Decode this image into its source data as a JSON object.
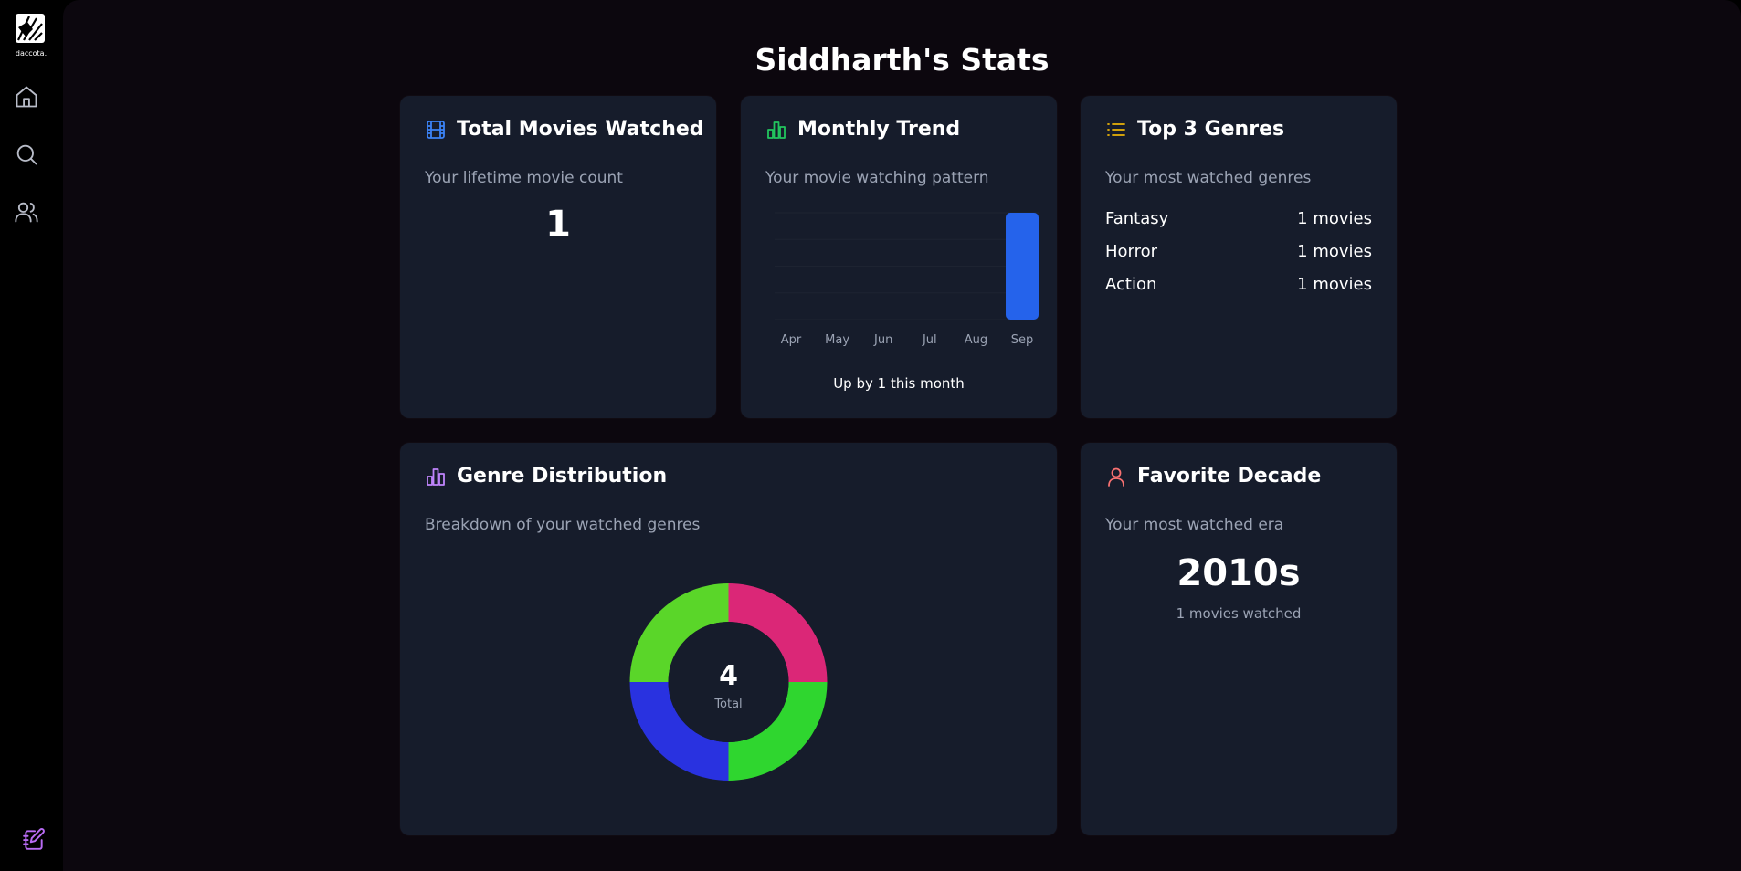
{
  "sidebar": {
    "logo_text": "daccota.",
    "items": [
      {
        "icon": "home-icon"
      },
      {
        "icon": "search-icon"
      },
      {
        "icon": "users-icon"
      }
    ],
    "bottom_icon": "edit-notebook-icon"
  },
  "page": {
    "title": "Siddharth's Stats"
  },
  "total_movies": {
    "title": "Total Movies Watched",
    "subtitle": "Your lifetime movie count",
    "value": "1",
    "icon": "film-icon",
    "icon_color": "#3b82f6"
  },
  "monthly_trend": {
    "title": "Monthly Trend",
    "subtitle": "Your movie watching pattern",
    "note": "Up by 1 this month",
    "icon": "bar-chart-icon",
    "icon_color": "#22c55e"
  },
  "top_genres": {
    "title": "Top 3 Genres",
    "subtitle": "Your most watched genres",
    "icon": "list-icon",
    "icon_color": "#eab308",
    "rows": [
      {
        "genre": "Fantasy",
        "count": "1 movies"
      },
      {
        "genre": "Horror",
        "count": "1 movies"
      },
      {
        "genre": "Action",
        "count": "1 movies"
      }
    ]
  },
  "genre_distribution": {
    "title": "Genre Distribution",
    "subtitle": "Breakdown of your watched genres",
    "total_value": "4",
    "total_label": "Total",
    "icon": "bar-chart-icon",
    "icon_color": "#c084fc"
  },
  "favorite_decade": {
    "title": "Favorite Decade",
    "subtitle": "Your most watched era",
    "value": "2010s",
    "caption": "1 movies watched",
    "icon": "user-icon",
    "icon_color": "#f87171"
  },
  "chart_data": [
    {
      "type": "bar",
      "categories": [
        "Apr",
        "May",
        "Jun",
        "Jul",
        "Aug",
        "Sep"
      ],
      "values": [
        0,
        0,
        0,
        0,
        0,
        1
      ],
      "color": "#2563eb"
    },
    {
      "type": "pie",
      "categories": [
        "",
        "",
        "",
        ""
      ],
      "values": [
        1,
        1,
        1,
        1
      ],
      "colors": [
        "#db2777",
        "#2fd62f",
        "#2932e0",
        "#5ad629"
      ]
    }
  ]
}
